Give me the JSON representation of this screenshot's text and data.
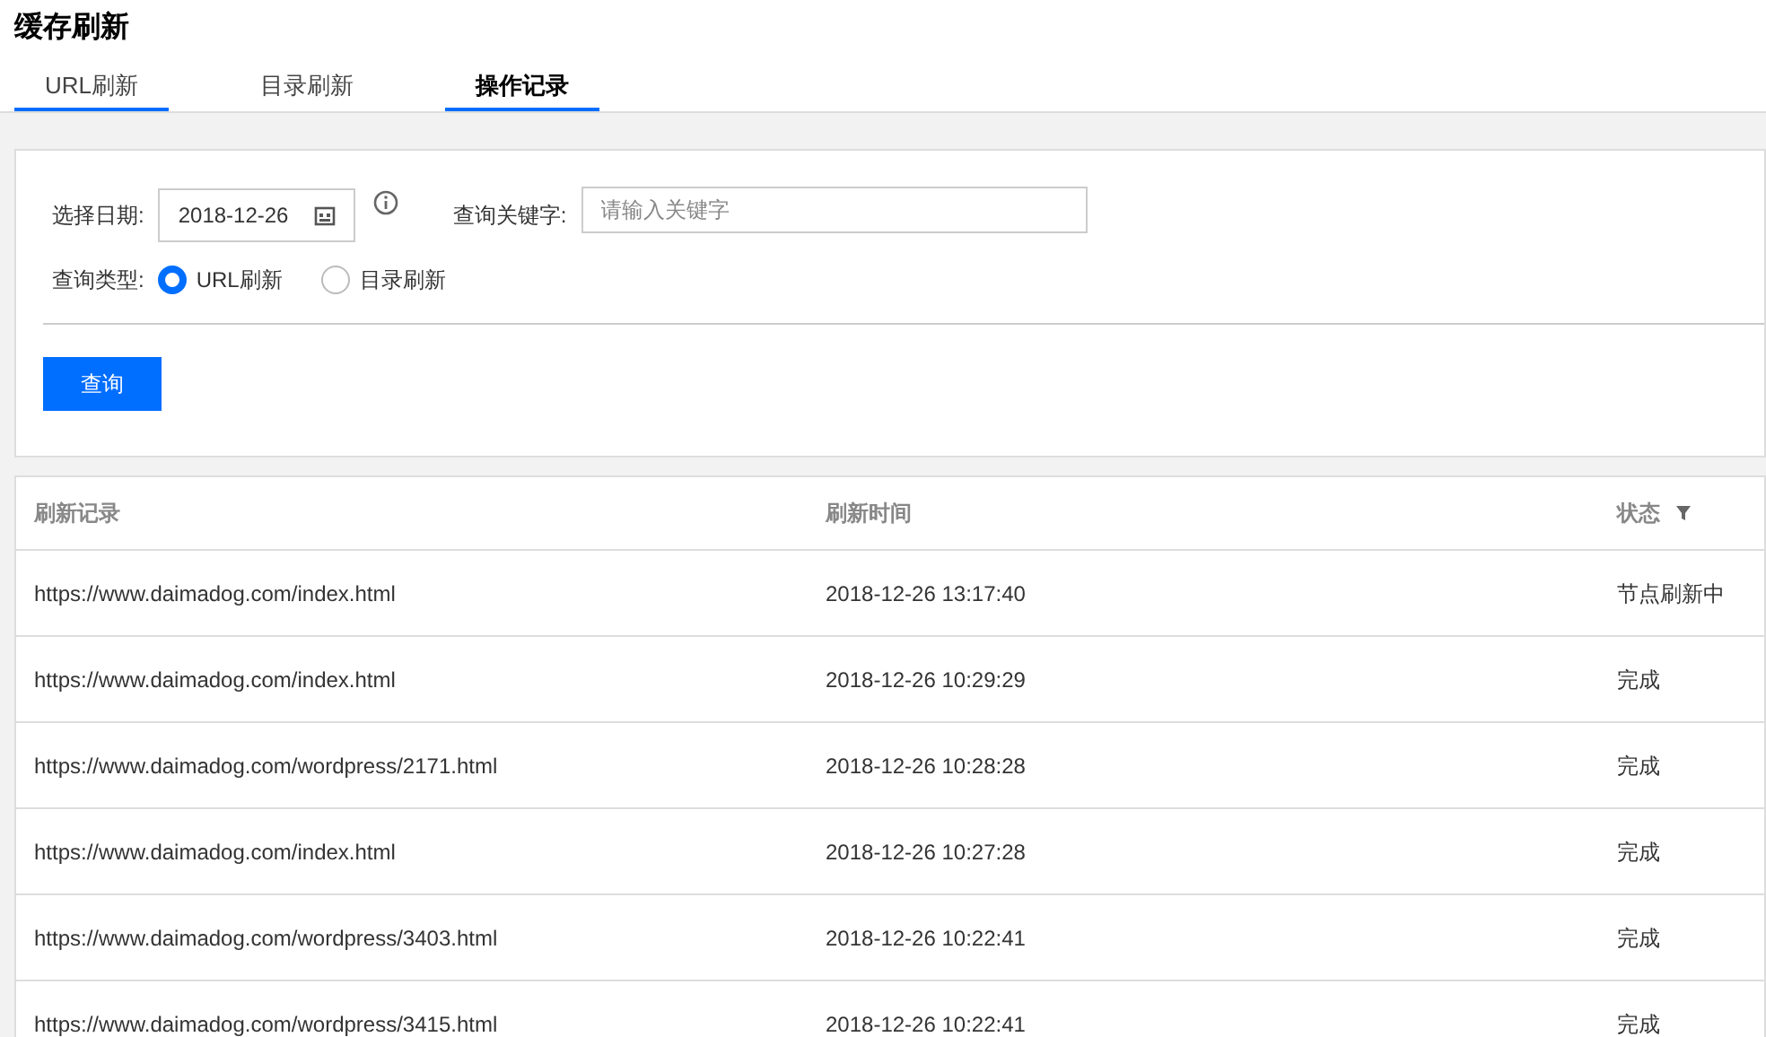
{
  "page_title": "缓存刷新",
  "tabs": [
    {
      "label": "URL刷新",
      "selected": false,
      "underlined": true
    },
    {
      "label": "目录刷新",
      "selected": false,
      "underlined": false
    },
    {
      "label": "操作记录",
      "selected": true,
      "underlined": true
    }
  ],
  "filters": {
    "date_label": "选择日期:",
    "date_value": "2018-12-26",
    "keyword_label": "查询关键字:",
    "keyword_placeholder": "请输入关键字",
    "type_label": "查询类型:",
    "types": [
      {
        "label": "URL刷新",
        "selected": true
      },
      {
        "label": "目录刷新",
        "selected": false
      }
    ],
    "query_button": "查询"
  },
  "table": {
    "columns": [
      "刷新记录",
      "刷新时间",
      "状态"
    ],
    "rows": [
      [
        "https://www.daimadog.com/index.html",
        "2018-12-26 13:17:40",
        "节点刷新中"
      ],
      [
        "https://www.daimadog.com/index.html",
        "2018-12-26 10:29:29",
        "完成"
      ],
      [
        "https://www.daimadog.com/wordpress/2171.html",
        "2018-12-26 10:28:28",
        "完成"
      ],
      [
        "https://www.daimadog.com/index.html",
        "2018-12-26 10:27:28",
        "完成"
      ],
      [
        "https://www.daimadog.com/wordpress/3403.html",
        "2018-12-26 10:22:41",
        "完成"
      ],
      [
        "https://www.daimadog.com/wordpress/3415.html",
        "2018-12-26 10:22:41",
        "完成"
      ]
    ]
  }
}
